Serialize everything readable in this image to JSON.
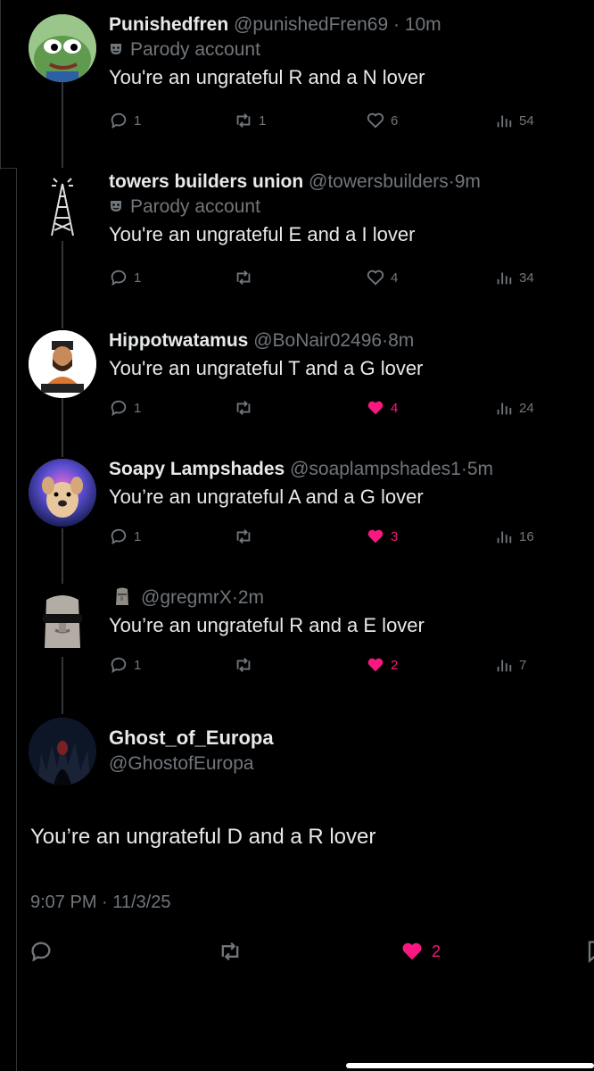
{
  "replies": [
    {
      "name": "Punishedfren",
      "handle": "@punishedFren69",
      "time": "10m",
      "parody_label": "Parody account",
      "text": "You're an ungrateful R and a N lover",
      "replies": "1",
      "reposts": "1",
      "likes": "6",
      "views": "54",
      "liked": false,
      "avatar_icon": "pepe-frog-avatar"
    },
    {
      "name": "towers builders union",
      "handle": "@towersbuilders",
      "time": "9m",
      "parody_label": "Parody account",
      "text": "You're an ungrateful E and a I lover",
      "replies": "1",
      "reposts": "",
      "likes": "4",
      "views": "34",
      "liked": false,
      "avatar_icon": "radio-tower-avatar"
    },
    {
      "name": "Hippotwatamus",
      "handle": "@BoNair02496",
      "time": "8m",
      "text": "You're an ungrateful T and a G lover",
      "replies": "1",
      "reposts": "",
      "likes": "4",
      "views": "24",
      "liked": true,
      "avatar_icon": "bearded-man-avatar"
    },
    {
      "name": "Soapy Lampshades",
      "handle": "@soaplampshades1",
      "time": "5m",
      "text": "You’re an ungrateful A and a G lover",
      "replies": "1",
      "reposts": "",
      "likes": "3",
      "views": "16",
      "liked": true,
      "avatar_icon": "dog-avatar"
    },
    {
      "name": "",
      "handle": "@gregmrX",
      "time": "2m",
      "text": "You’re an ungrateful R and a E lover",
      "replies": "1",
      "reposts": "",
      "likes": "2",
      "views": "7",
      "liked": true,
      "avatar_icon": "moai-sunglasses-avatar"
    }
  ],
  "main": {
    "name": "Ghost_of_Europa",
    "handle": "@GhostofEuropa",
    "text": "You’re an ungrateful D and a R lover",
    "timestamp": "9:07 PM · 11/3/25",
    "likes": "2",
    "liked": true
  },
  "colors": {
    "background": "#000000",
    "text": "#e7e9ea",
    "secondary": "#71767b",
    "like": "#f91880"
  }
}
